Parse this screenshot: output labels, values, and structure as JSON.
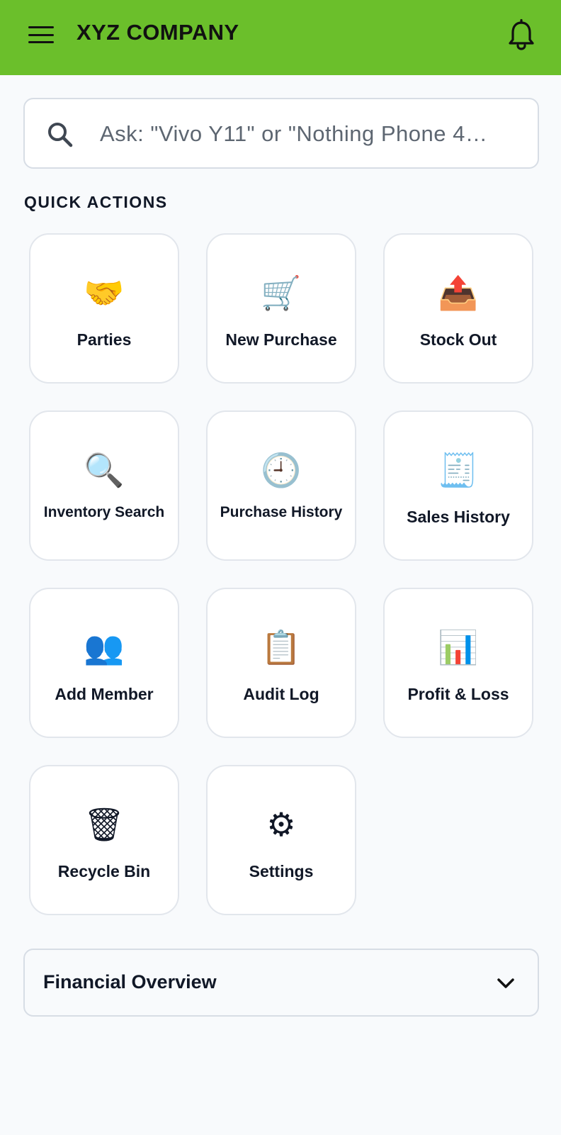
{
  "app_bar": {
    "title": "XYZ COMPANY",
    "menu_icon": "hamburger-menu-icon",
    "bell_icon": "bell-icon",
    "background_color": "#6bbf2b"
  },
  "search": {
    "placeholder": "Ask: \"Vivo Y11\" or \"Nothing Phone 4…",
    "value": "",
    "icon": "search-icon"
  },
  "quick_actions": {
    "heading": "QUICK ACTIONS",
    "items": [
      {
        "label": "Parties",
        "icon": "🤝",
        "icon_name": "handshake-icon"
      },
      {
        "label": "New Purchase",
        "icon": "🛒",
        "icon_name": "shopping-cart-icon"
      },
      {
        "label": "Stock Out",
        "icon": "📤",
        "icon_name": "outbox-tray-icon"
      },
      {
        "label": "Inventory Search",
        "icon": "🔍",
        "icon_name": "magnifying-glass-icon"
      },
      {
        "label": "Purchase History",
        "icon": "🕘",
        "icon_name": "clock-icon"
      },
      {
        "label": "Sales History",
        "icon": "🧾",
        "icon_name": "receipt-icon"
      },
      {
        "label": "Add Member",
        "icon": "👥",
        "icon_name": "people-icon"
      },
      {
        "label": "Audit Log",
        "icon": "📋",
        "icon_name": "clipboard-icon"
      },
      {
        "label": "Profit & Loss",
        "icon": "📊",
        "icon_name": "bar-chart-icon"
      },
      {
        "label": "Recycle Bin",
        "icon": "🗑",
        "icon_name": "wastebasket-icon"
      },
      {
        "label": "Settings",
        "icon": "⚙",
        "icon_name": "gear-icon"
      }
    ]
  },
  "financial_overview": {
    "title": "Financial Overview",
    "chevron_icon": "chevron-down-icon"
  }
}
